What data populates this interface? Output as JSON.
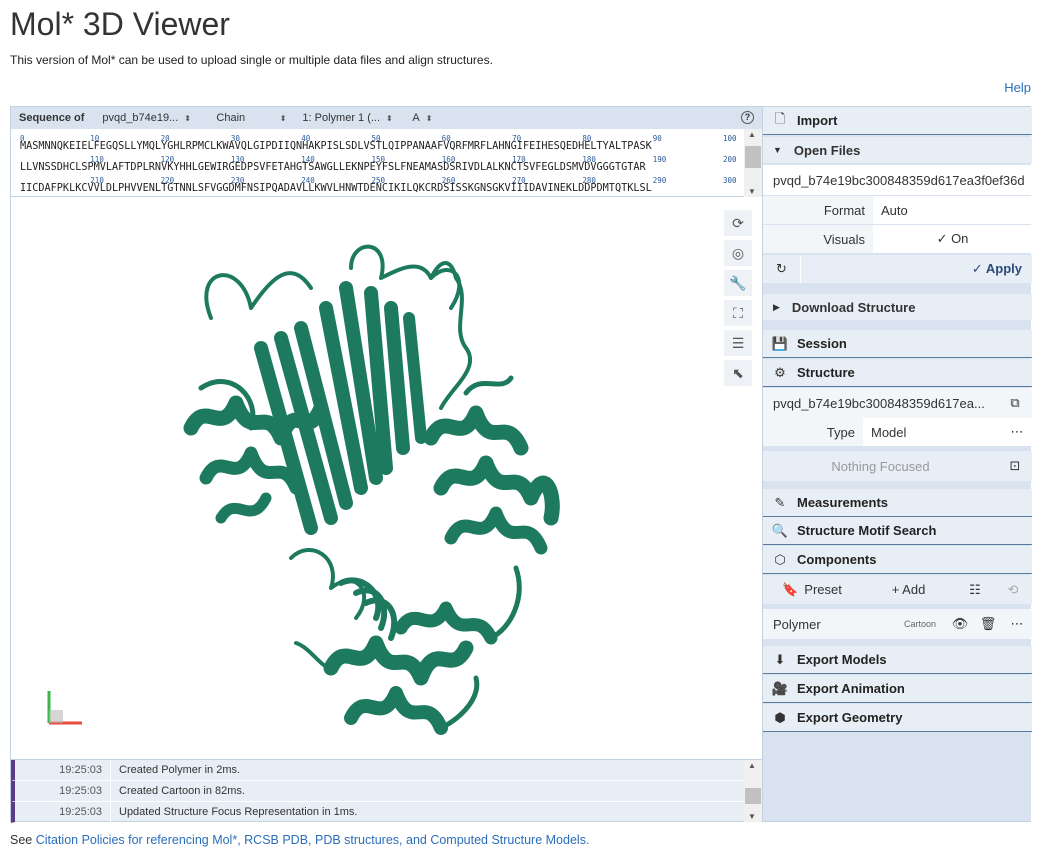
{
  "page": {
    "title": "Mol* 3D Viewer",
    "subtitle": "This version of Mol* can be used to upload single or multiple data files and align structures.",
    "help": "Help",
    "footer_prefix": "See ",
    "footer_link": "Citation Policies for referencing Mol*, RCSB PDB, PDB structures, and Computed Structure Models."
  },
  "sequence": {
    "label": "Sequence of",
    "entry": "pvqd_b74e19...",
    "mode": "Chain",
    "polymer": "1: Polymer 1 (...",
    "chain": "A",
    "lines": [
      {
        "nums": [
          "0",
          "10",
          "20",
          "30",
          "40",
          "50",
          "60",
          "70",
          "80",
          "90",
          "100"
        ],
        "text": "MASMNNQKEIELFEGQSLLYMQLYGHLRPMCLKWAVQLGIPDIIQNHAKPISLSDLVSTLQIPPANAAFVQRFMRFLAHNGIFEIHESQEDHELTYALTPASK"
      },
      {
        "nums": [
          "110",
          "120",
          "130",
          "140",
          "150",
          "160",
          "170",
          "180",
          "190",
          "200"
        ],
        "text": "LLVNSSDHCLSPMVLAFTDPLRNVKYHHLGEWIRGEDPSVFETAHGTSAWGLLEKNPEYFSLFNEAMASDSRIVDLALKNCTSVFEGLDSMVDVGGGTGTAR"
      },
      {
        "nums": [
          "210",
          "220",
          "230",
          "240",
          "250",
          "260",
          "270",
          "280",
          "290",
          "300"
        ],
        "text": "IICDAFPKLKCVVLDLPHVVENLTGTNNLSFVGGDMFNSIPQADAVLLKWVLHNWTDENCIKILQKCRDSISSKGNSGKVIIIDAVINEKLDDPDMTQTKLSL"
      }
    ]
  },
  "log": [
    {
      "time": "19:25:03",
      "msg": "Created Polymer in 2ms."
    },
    {
      "time": "19:25:03",
      "msg": "Created Cartoon in 82ms."
    },
    {
      "time": "19:25:03",
      "msg": "Updated Structure Focus Representation in 1ms."
    }
  ],
  "panel": {
    "import": "Import",
    "open_files": "Open Files",
    "file_name": "pvqd_b74e19bc300848359d617ea3f0ef36d",
    "format_label": "Format",
    "format_value": "Auto",
    "visuals_label": "Visuals",
    "visuals_value": "✓ On",
    "apply": "✓ Apply",
    "download": "Download Structure",
    "session": "Session",
    "structure": "Structure",
    "structure_name": "pvqd_b74e19bc300848359d617ea...",
    "type_label": "Type",
    "type_value": "Model",
    "nothing_focused": "Nothing Focused",
    "measurements": "Measurements",
    "motif": "Structure Motif Search",
    "components": "Components",
    "preset": "Preset",
    "add": "+ Add",
    "polymer": "Polymer",
    "cartoon": "Cartoon",
    "export_models": "Export Models",
    "export_animation": "Export Animation",
    "export_geometry": "Export Geometry"
  },
  "colors": {
    "protein": "#1e7a5f",
    "link": "#2a6ebb",
    "panel_bg": "#d8e3ef",
    "header_bg": "#e8eef5",
    "log_marker": "#5c3a8a"
  }
}
